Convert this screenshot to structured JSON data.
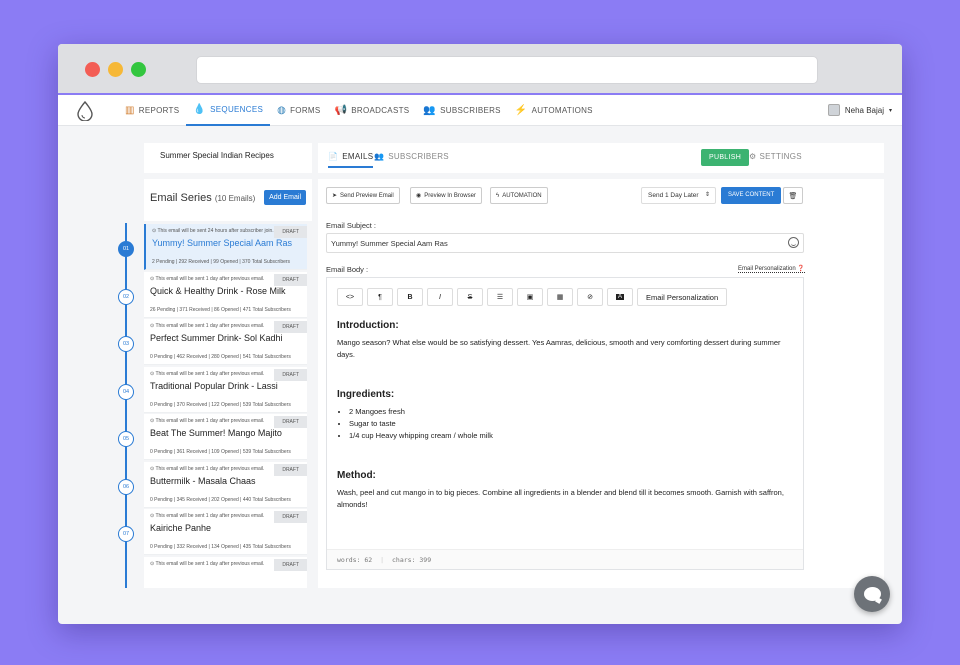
{
  "nav": {
    "items": [
      {
        "label": "REPORTS",
        "icon": "bar-chart-icon"
      },
      {
        "label": "SEQUENCES",
        "icon": "droplets-icon"
      },
      {
        "label": "FORMS",
        "icon": "globe-icon"
      },
      {
        "label": "BROADCASTS",
        "icon": "megaphone-icon"
      },
      {
        "label": "SUBSCRIBERS",
        "icon": "users-icon"
      },
      {
        "label": "AUTOMATIONS",
        "icon": "lightning-icon"
      }
    ],
    "active": "SEQUENCES",
    "user_name": "Neha Bajaj"
  },
  "sequence": {
    "name": "Summer Special Indian Recipes",
    "tabs": {
      "emails": "EMAILS",
      "subscribers": "SUBSCRIBERS"
    },
    "publish_label": "PUBLISH",
    "settings_label": "SETTINGS"
  },
  "series": {
    "title": "Email Series",
    "count_label": "(10 Emails)",
    "add_label": "Add Email",
    "emails": [
      {
        "num": "01",
        "note": "⊙ This email will be sent 24 hours after subscriber join.",
        "title": "Yummy! Summer Special Aam Ras",
        "stats": "2 Pending  |  292 Received  |  99 Opened  |  370 Total Subscribers",
        "status": "DRAFT"
      },
      {
        "num": "02",
        "note": "⊙ This email will be sent 1 day after previous email.",
        "title": "Quick & Healthy Drink - Rose Milk",
        "stats": "26 Pending  |  371 Received  |  86 Opened  |  471 Total Subscribers",
        "status": "DRAFT"
      },
      {
        "num": "03",
        "note": "⊙ This email will be sent 1 day after previous email.",
        "title": "Perfect Summer Drink- Sol Kadhi",
        "stats": "0 Pending  |  462 Received  |  280 Opened  |  541 Total Subscribers",
        "status": "DRAFT"
      },
      {
        "num": "04",
        "note": "⊙ This email will be sent 1 day after previous email.",
        "title": "Traditional Popular Drink - Lassi",
        "stats": "0 Pending  |  370 Received  |  122 Opened  |  539 Total Subscribers",
        "status": "DRAFT"
      },
      {
        "num": "05",
        "note": "⊙ This email will be sent 1 day after previous email.",
        "title": "Beat The Summer! Mango Majito",
        "stats": "0 Pending  |  361 Received  |  109 Opened  |  539 Total Subscribers",
        "status": "DRAFT"
      },
      {
        "num": "06",
        "note": "⊙ This email will be sent 1 day after previous email.",
        "title": "Buttermilk - Masala Chaas",
        "stats": "0 Pending  |  345 Received  |  202 Opened  |  440 Total Subscribers",
        "status": "DRAFT"
      },
      {
        "num": "07",
        "note": "⊙ This email will be sent 1 day after previous email.",
        "title": "Kairiche  Panhe",
        "stats": "0 Pending  |  332 Received  |  134 Opened  |  435 Total Subscribers",
        "status": "DRAFT"
      },
      {
        "num": "",
        "note": "⊙ This email will be sent 1 day after previous email.",
        "title": "",
        "stats": "",
        "status": "DRAFT"
      }
    ]
  },
  "editor": {
    "send_preview": "Send Preview Email",
    "preview_browser": "Preview In Browser",
    "automation": "AUTOMATION",
    "send_timing": "Send 1 Day Later",
    "save_label": "SAVE CONTENT",
    "subject_label": "Email Subject :",
    "subject_value": "Yummy! Summer Special Aam Ras",
    "body_label": "Email Body :",
    "personalization_link": "Email Personalization",
    "toolbar": {
      "code": "<>",
      "paragraph": "¶",
      "bold": "B",
      "italic": "I",
      "strike": "S",
      "personalization": "Email Personalization"
    },
    "body": {
      "intro_heading": "Introduction:",
      "intro_text": "Mango season? What else would be so satisfying dessert. Yes Aamras, delicious, smooth and very comforting dessert during summer days.",
      "ingredients_heading": "Ingredients:",
      "ingredients": [
        "2 Mangoes fresh",
        "Sugar to taste",
        "1/4 cup Heavy whipping cream / whole milk"
      ],
      "method_heading": "Method:",
      "method_text": "Wash, peel and cut mango in to big pieces. Combine all ingredients in a blender and blend till it becomes smooth. Garnish with saffron, almonds!"
    },
    "counter": {
      "words": "words: 62",
      "chars": "chars: 399"
    }
  }
}
